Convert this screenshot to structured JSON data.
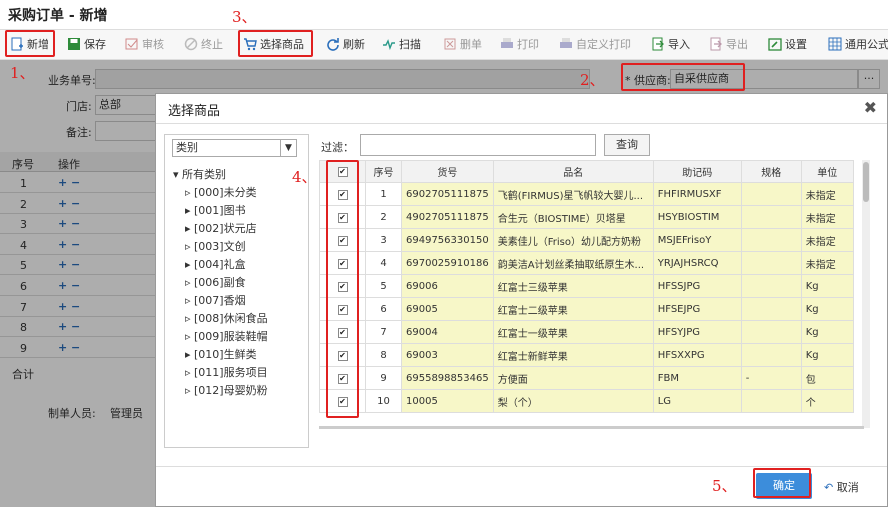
{
  "title": "采购订单 - 新增",
  "toolbar": {
    "new": "新增",
    "save": "保存",
    "audit": "审核",
    "stop": "终止",
    "select_goods": "选择商品",
    "refresh": "刷新",
    "scan": "扫描",
    "delete": "删单",
    "print": "打印",
    "custom_print": "自定义打印",
    "import": "导入",
    "export": "导出",
    "settings": "设置",
    "common_formula": "通用公式"
  },
  "form": {
    "order_no_label": "业务单号:",
    "store_label": "门店:",
    "store_value": "总部",
    "remark_label": "备注:",
    "supplier_label": "* 供应商:",
    "supplier_value": "自采供应商",
    "creator_label": "制单人员:",
    "creator_value": "管理员",
    "more": "···"
  },
  "bg_grid": {
    "headers": [
      "序号",
      "操作"
    ],
    "rows": [
      "1",
      "2",
      "3",
      "4",
      "5",
      "6",
      "7",
      "8",
      "9"
    ],
    "total": "合计",
    "ops": "+ −"
  },
  "annotations": {
    "a1": "1、",
    "a2": "2、",
    "a3": "3、",
    "a4": "4、",
    "a5": "5、"
  },
  "modal": {
    "title": "选择商品",
    "close": "✖",
    "category_select": "类别",
    "tree_root": "所有类别",
    "tree_items": [
      "[000]未分类",
      "[001]图书",
      "[002]状元店",
      "[003]文创",
      "[004]礼盒",
      "[006]副食",
      "[007]香烟",
      "[008]休闲食品",
      "[009]服装鞋帽",
      "[010]生鲜类",
      "[011]服务项目",
      "[012]母婴奶粉"
    ],
    "filter_label": "过滤：",
    "query": "查询",
    "columns": [
      "序号",
      "货号",
      "品名",
      "助记码",
      "规格",
      "单位"
    ],
    "rows": [
      {
        "no": "1",
        "code": "6902705111875",
        "name": "飞鹤(FIRMUS)星飞帆较大婴儿...",
        "mnemonic": "FHFIRMUSXF",
        "spec": "",
        "unit": "未指定"
      },
      {
        "no": "2",
        "code": "4902705111875",
        "name": "合生元（BIOSTIME）贝塔星",
        "mnemonic": "HSYBIOSTIM",
        "spec": "",
        "unit": "未指定"
      },
      {
        "no": "3",
        "code": "6949756330150",
        "name": "美素佳儿（Friso）幼儿配方奶粉",
        "mnemonic": "MSJEFrisoY",
        "spec": "",
        "unit": "未指定"
      },
      {
        "no": "4",
        "code": "6970025910186",
        "name": "韵美洁A计划丝柔抽取纸原生木...",
        "mnemonic": "YRJAJHSRCQ",
        "spec": "",
        "unit": "未指定"
      },
      {
        "no": "5",
        "code": "69006",
        "name": "红富士三级苹果",
        "mnemonic": "HFSSJPG",
        "spec": "",
        "unit": "Kg"
      },
      {
        "no": "6",
        "code": "69005",
        "name": "红富士二级苹果",
        "mnemonic": "HFSEJPG",
        "spec": "",
        "unit": "Kg"
      },
      {
        "no": "7",
        "code": "69004",
        "name": "红富士一级苹果",
        "mnemonic": "HFSYJPG",
        "spec": "",
        "unit": "Kg"
      },
      {
        "no": "8",
        "code": "69003",
        "name": "红富士新鲜苹果",
        "mnemonic": "HFSXXPG",
        "spec": "",
        "unit": "Kg"
      },
      {
        "no": "9",
        "code": "6955898853465",
        "name": "方便面",
        "mnemonic": "FBM",
        "spec": "-",
        "unit": "包"
      },
      {
        "no": "10",
        "code": "10005",
        "name": "梨（个）",
        "mnemonic": "LG",
        "spec": "",
        "unit": "个"
      }
    ],
    "ok": "确定",
    "cancel": "取消"
  }
}
